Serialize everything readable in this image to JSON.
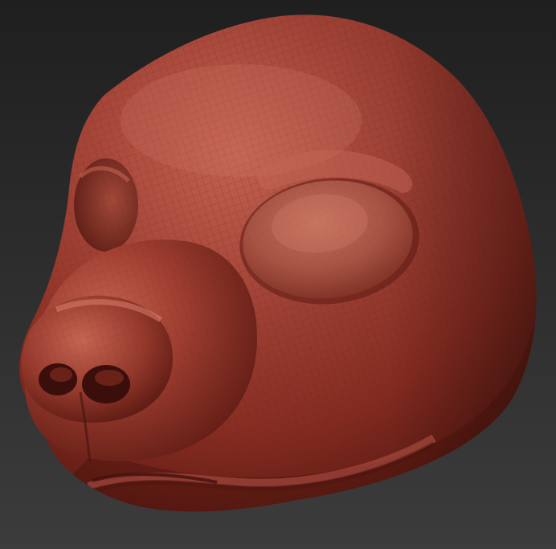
{
  "scene": {
    "subject": "sculpted-animal-head-mask",
    "colors": {
      "background_top": "#1f1f1f",
      "background_bottom": "#3c3c3c",
      "clay_base": "#8e2f23",
      "clay_highlight": "#c86553",
      "clay_shadow": "#4b1510",
      "eye_socket": "#b8614f",
      "nostril_shadow": "#3a0f0b",
      "wire_lines": "#7a251b"
    }
  }
}
